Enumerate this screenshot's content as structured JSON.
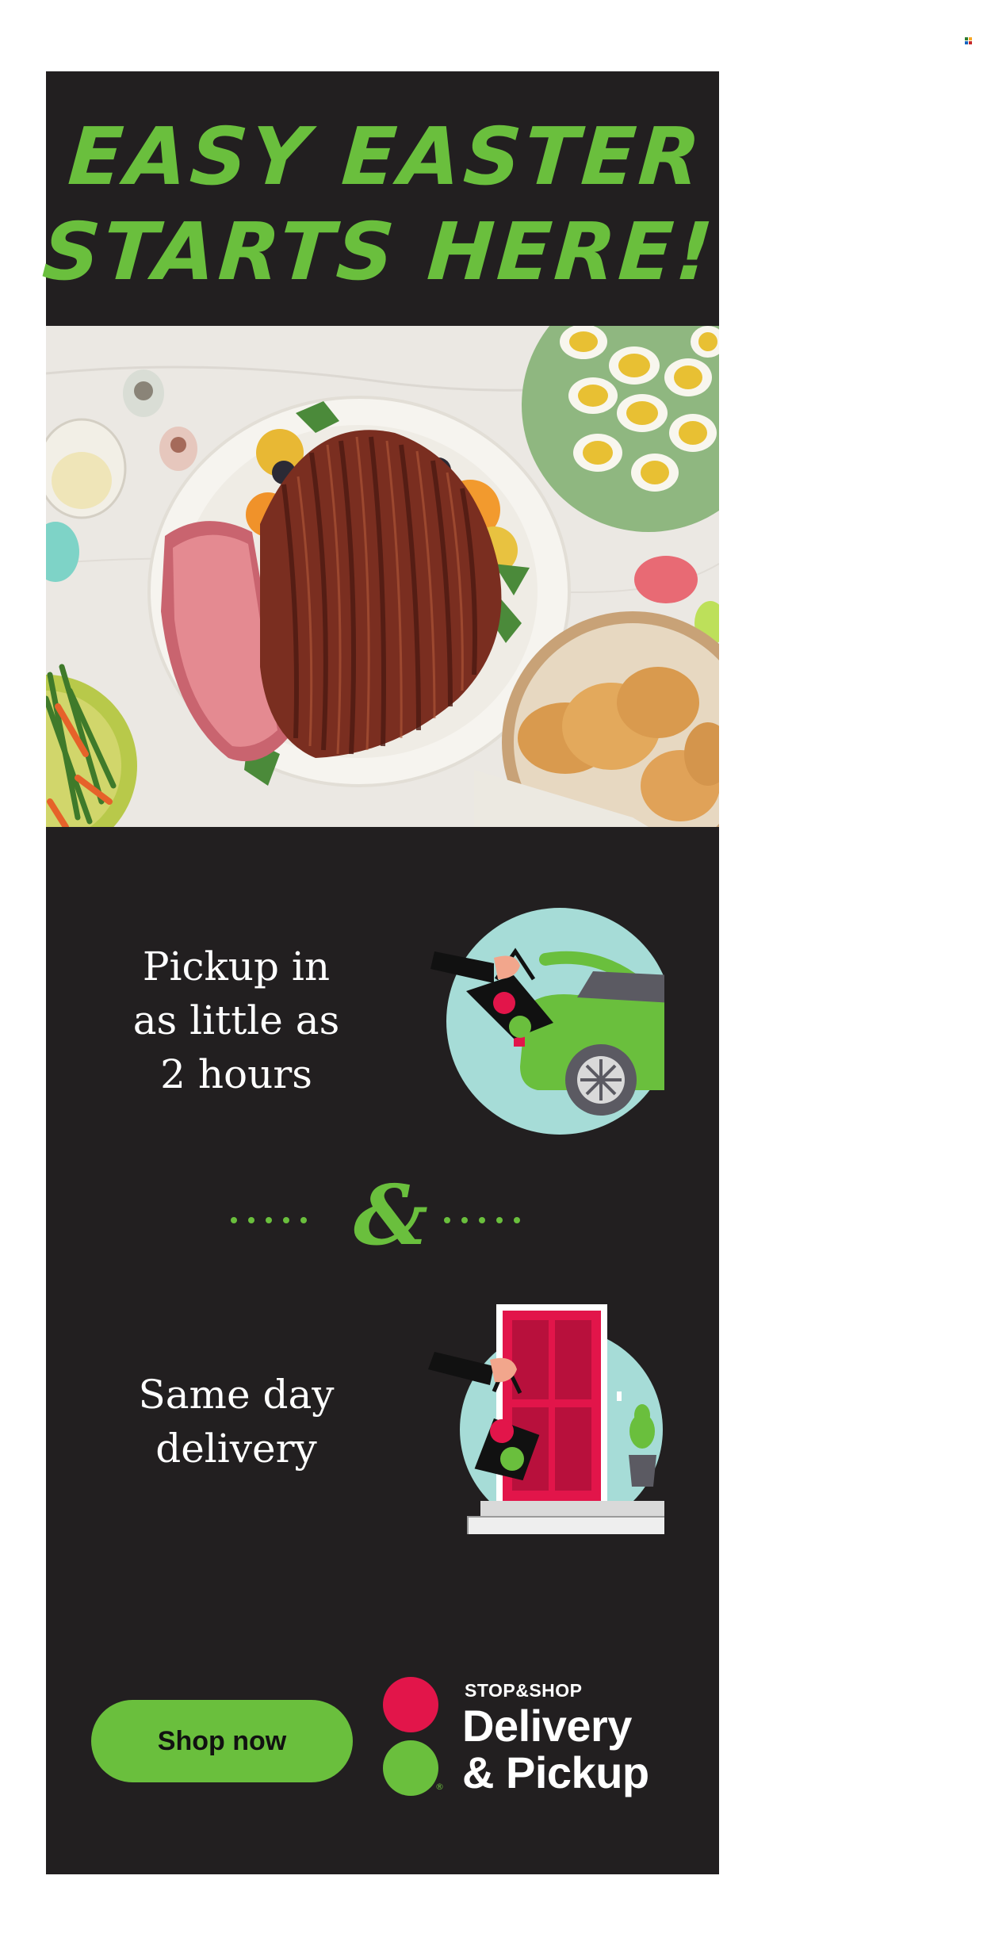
{
  "banner": {
    "headline_line1": "EASY EASTER",
    "headline_line2": "STARTS HERE!",
    "photo_alt": "Easter ham platter with deviled eggs, rolls and vegetables",
    "pickup_text": [
      "Pickup in",
      "as little as",
      "2 hours"
    ],
    "separator": "&",
    "delivery_text": [
      "Same day",
      "delivery"
    ],
    "cta_label": "Shop now",
    "logo": {
      "brand": "STOP&SHOP",
      "line1": "Delivery",
      "line2": "& Pickup",
      "registered": "®"
    },
    "icons": [
      "pickup-car-icon",
      "delivery-door-icon",
      "shopping-bag-icon"
    ]
  },
  "colors": {
    "background": "#221f20",
    "accent_green": "#6abf3d",
    "accent_red": "#e2154a",
    "mint": "#a6dcd7"
  }
}
